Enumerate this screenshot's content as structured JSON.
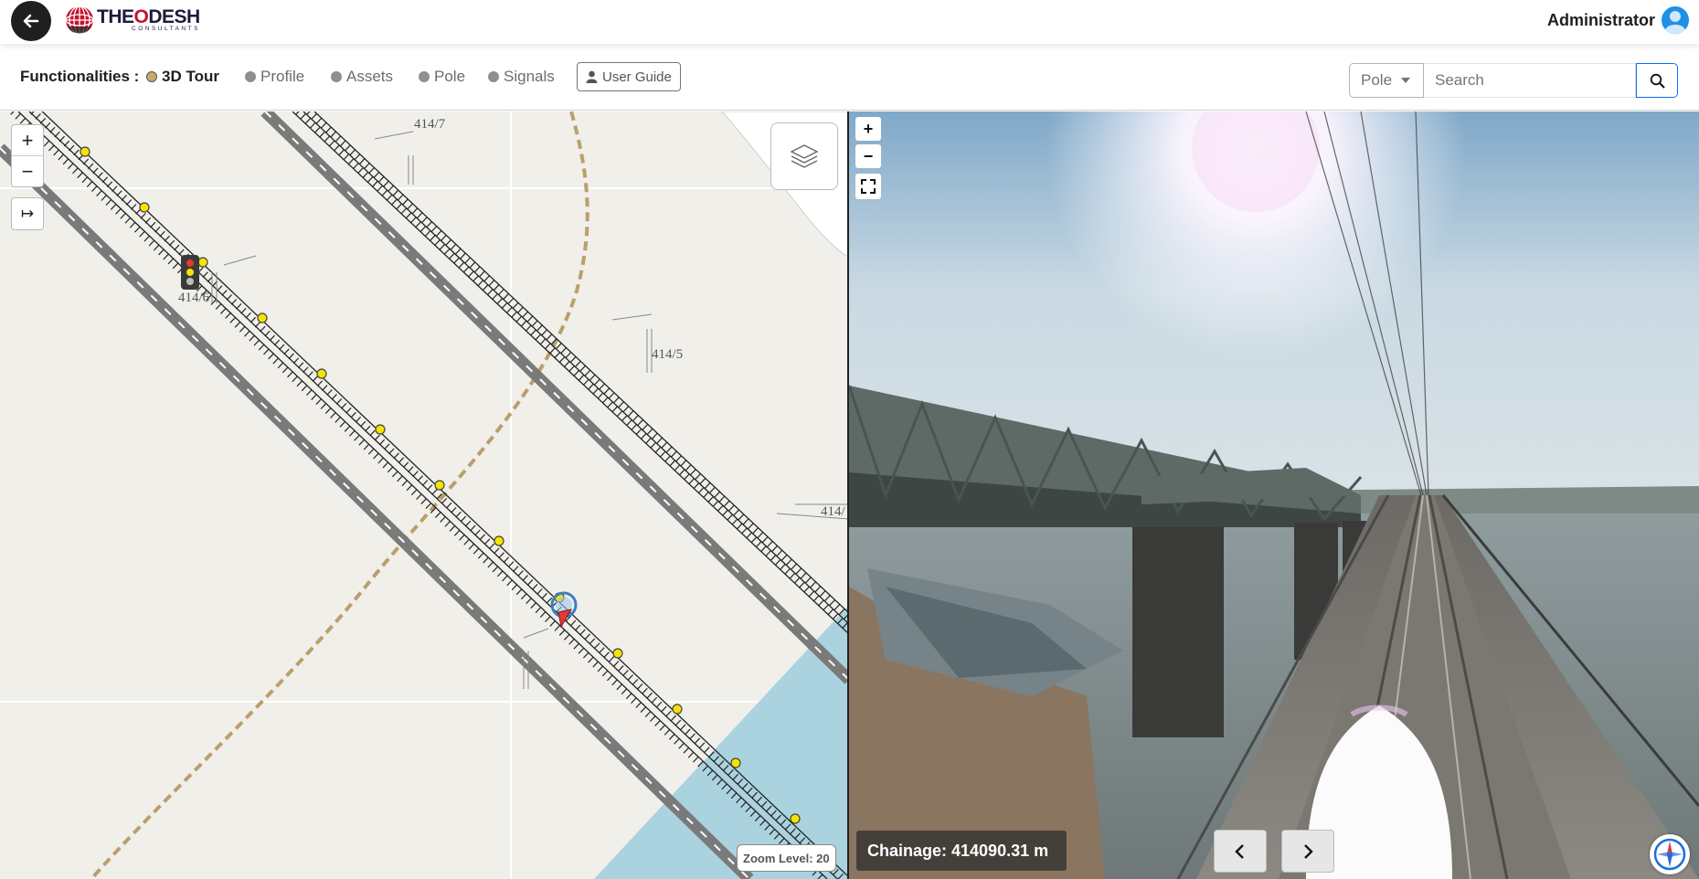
{
  "header": {
    "brand_main": "THE",
    "brand_accent": "O",
    "brand_tail": "DESH",
    "brand_sub": "CONSULTANTS",
    "user_name": "Administrator"
  },
  "toolbar": {
    "label": "Functionalities :",
    "options": [
      {
        "label": "3D Tour",
        "active": true
      },
      {
        "label": "Profile",
        "active": false
      },
      {
        "label": "Assets",
        "active": false
      },
      {
        "label": "Pole",
        "active": false
      },
      {
        "label": "Signals",
        "active": false
      }
    ],
    "user_guide": "User Guide",
    "search_type": "Pole",
    "search_placeholder": "Search"
  },
  "map": {
    "zoom_in": "+",
    "zoom_out": "−",
    "fit_icon": "↦",
    "pole_labels": [
      "414/7",
      "414/6",
      "414/5",
      "414/"
    ],
    "zoom_level": "Zoom Level: 20"
  },
  "view": {
    "zoom_in": "+",
    "zoom_out": "−",
    "chainage": "Chainage: 414090.31 m"
  },
  "colors": {
    "accent": "#0d6efd",
    "active_dot": "#c9a86a",
    "water": "#aad3df",
    "map_bg": "#f1efea"
  },
  "icons": {
    "back": "arrow-left-icon",
    "search": "magnifier-icon",
    "layers": "layers-icon",
    "compass": "compass-icon",
    "guide": "person-icon"
  }
}
